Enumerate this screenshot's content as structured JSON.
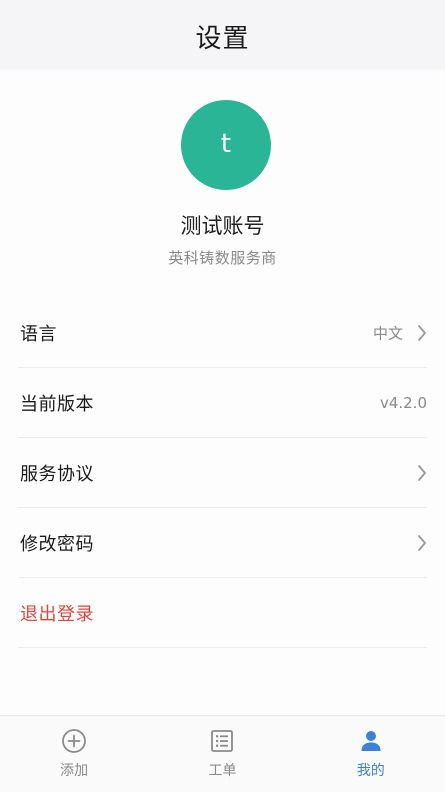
{
  "header": {
    "title": "设置"
  },
  "profile": {
    "avatar_letter": "t",
    "avatar_color": "#2bb597",
    "name": "测试账号",
    "company": "英科铸数服务商"
  },
  "menu": {
    "items": [
      {
        "label": "语言",
        "value": "中文",
        "chevron": true
      },
      {
        "label": "当前版本",
        "value": "v4.2.0",
        "chevron": false
      },
      {
        "label": "服务协议",
        "value": "",
        "chevron": true
      },
      {
        "label": "修改密码",
        "value": "",
        "chevron": true
      },
      {
        "label": "退出登录",
        "value": "",
        "chevron": false,
        "danger": true
      }
    ]
  },
  "tabbar": {
    "tabs": [
      {
        "label": "添加",
        "icon": "plus-circle-icon",
        "active": false
      },
      {
        "label": "工单",
        "icon": "list-icon",
        "active": false
      },
      {
        "label": "我的",
        "icon": "person-icon",
        "active": true
      }
    ]
  },
  "colors": {
    "accent": "#3b82d6",
    "danger": "#e0463f",
    "avatar": "#2bb597"
  }
}
